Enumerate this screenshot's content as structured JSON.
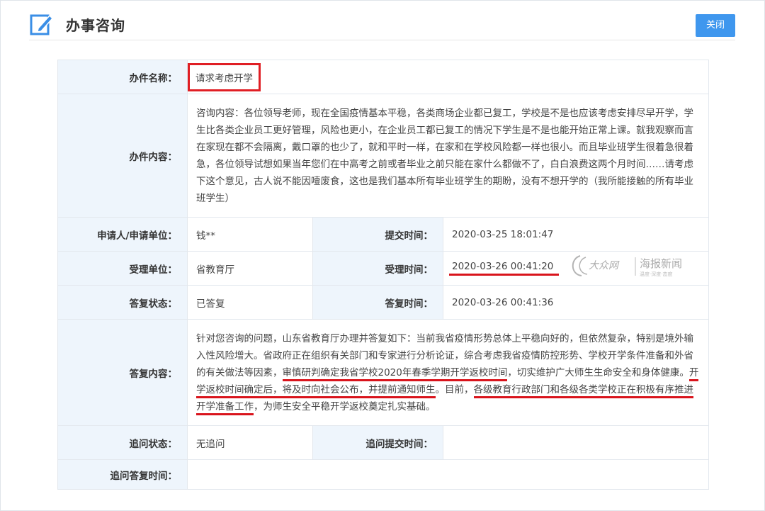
{
  "header": {
    "title": "办事咨询",
    "close_label": "关闭",
    "icon": "edit-icon"
  },
  "labels": {
    "item_name": "办件名称：",
    "item_content": "办件内容：",
    "applicant": "申请人/申请单位：",
    "submit_time": "提交时间：",
    "handling_unit": "受理单位：",
    "accept_time": "受理时间：",
    "reply_status": "答复状态：",
    "reply_time": "答复时间：",
    "reply_content": "答复内容：",
    "followup_status": "追问状态：",
    "followup_submit_time": "追问提交时间：",
    "followup_reply_time": "追问答复时间："
  },
  "values": {
    "item_name": "请求考虑开学",
    "item_content": "咨询内容：各位领导老师，现在全国疫情基本平稳，各类商场企业都已复工，学校是不是也应该考虑安排尽早开学，学生比各类企业员工更好管理，风险也更小，在企业员工都已复工的情况下学生是不是也能开始正常上课。就我观察而言在家现在都不会隔离，戴口罩的也少了，就和平时一样，在家和在学校风险都一样也很小。而且毕业班学生很着急很着急，各位领导试想如果当年您们在中高考之前或者毕业之前只能在家什么都做不了，白白浪费这两个月时间……请考虑下这个意见，古人说不能因噎废食，这也是我们基本所有毕业班学生的期盼，没有不想开学的（我所能接触的所有毕业班学生）",
    "applicant": "钱**",
    "submit_time": "2020-03-25 18:01:47",
    "handling_unit": "省教育厅",
    "accept_time": "2020-03-26 00:41:20",
    "reply_status": "已答复",
    "reply_time": "2020-03-26 00:41:36",
    "reply_parts": [
      "针对您咨询的问题，山东省教育厅办理并答复如下：当前我省疫情形势总体上平稳向好的，但依然复杂，特别是境外输入性风险增大。省政府正在组织有关部门和专家进行分析论证，综合考虑我省疫情防控形势、学校开学条件准备和外省的有关做法等因素，",
      "审慎研判确定我省学校2020年春季学期开学返校时间",
      "，切实维护广大师生生命安全和身体健康。",
      "开学返校时间确定后，将及时向社会公布，并提前通知师生",
      "。目前，",
      "各级教育行政部门和各级各类学校正在积极有序推进开学准备工作",
      "，为师生安全平稳开学返校奠定扎实基础。"
    ],
    "followup_status": "无追问",
    "followup_submit_time": "",
    "followup_reply_time": ""
  },
  "watermark": {
    "left_text": "大众网",
    "right_text": "海报新闻",
    "sub_text": "温度·深度·态度"
  },
  "colors": {
    "accent": "#3f97ee",
    "label_bg": "#eef5fc",
    "highlight": "#d9141c"
  }
}
